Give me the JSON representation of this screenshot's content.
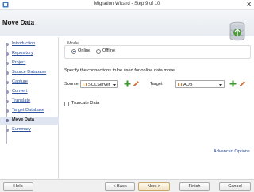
{
  "window": {
    "title": "Migration Wizard - Step 9 of 10",
    "close_glyph": "✕"
  },
  "header": {
    "heading": "Move Data"
  },
  "steps": [
    {
      "label": "Introduction",
      "current": false
    },
    {
      "label": "Repository",
      "current": false
    },
    {
      "label": "Project",
      "current": false
    },
    {
      "label": "Source Database",
      "current": false
    },
    {
      "label": "Capture",
      "current": false
    },
    {
      "label": "Convert",
      "current": false
    },
    {
      "label": "Translate",
      "current": false
    },
    {
      "label": "Target Database",
      "current": false
    },
    {
      "label": "Move Data",
      "current": true
    },
    {
      "label": "Summary",
      "current": false
    }
  ],
  "mode": {
    "legend": "Mode",
    "options": [
      {
        "label": "Online",
        "selected": true
      },
      {
        "label": "Offline",
        "selected": false
      }
    ]
  },
  "description": "Specify the connections to be used for online data move.",
  "source": {
    "label": "Source",
    "value": "SQLServer"
  },
  "target": {
    "label": "Target",
    "value": "ADB"
  },
  "truncate": {
    "label": "Truncate Data",
    "checked": false
  },
  "advanced_link": "Advanced Options",
  "buttons": {
    "help": "Help",
    "back": "< Back",
    "next": "Next >",
    "finish": "Finish",
    "cancel": "Cancel"
  },
  "colors": {
    "link": "#2a4f9c",
    "current_step_bg": "#dfe6f2",
    "add_green": "#3a9a2a",
    "edit_orange": "#d8743a"
  }
}
